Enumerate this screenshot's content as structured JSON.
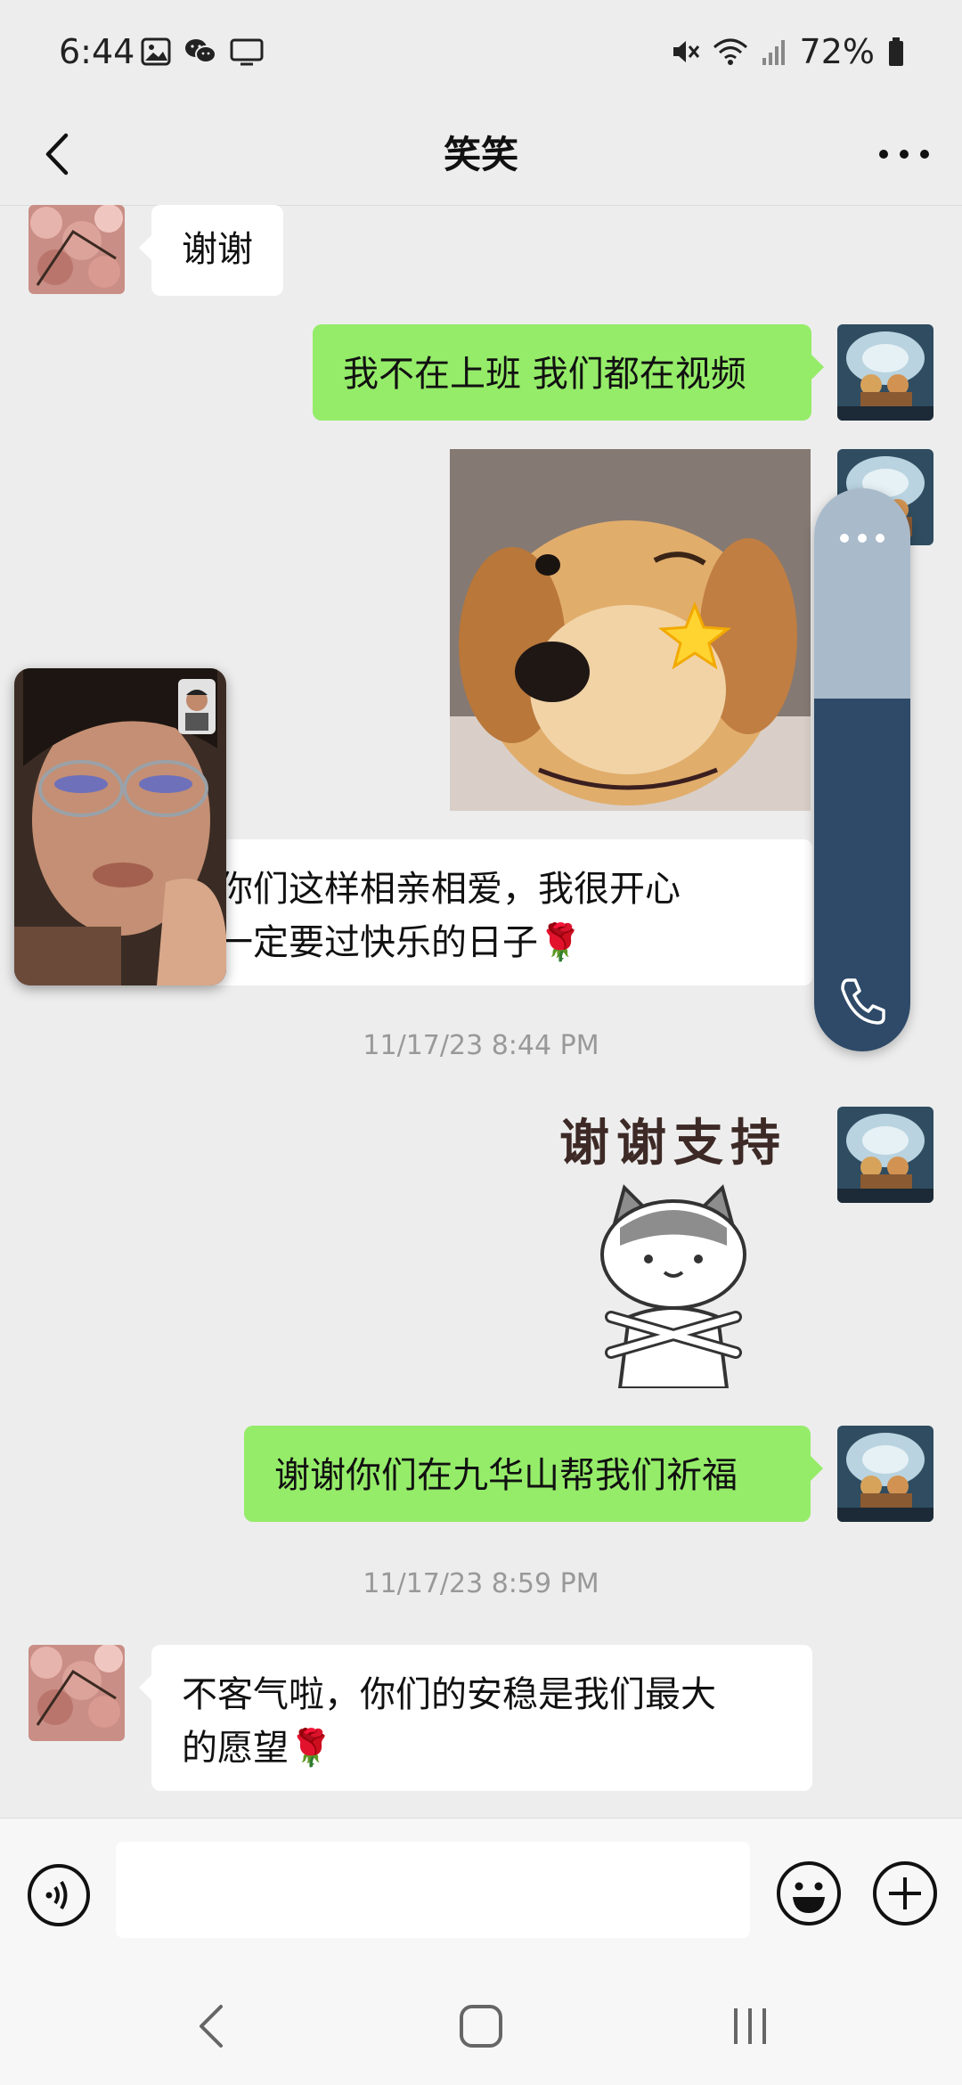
{
  "status_bar": {
    "time": "6:44",
    "battery": "72%",
    "icons_left": [
      "gallery-icon",
      "wechat-icon",
      "cast-icon"
    ],
    "icons_right": [
      "mute-icon",
      "wifi-icon",
      "signal-icon",
      "battery-icon"
    ]
  },
  "header": {
    "title": "笑笑"
  },
  "messages": [
    {
      "side": "in",
      "type": "text",
      "text": "谢谢"
    },
    {
      "side": "out",
      "type": "text",
      "text": "我不在上班 我们都在视频"
    },
    {
      "side": "out",
      "type": "image",
      "image": "golden-retriever-wink-sticker"
    },
    {
      "side": "in",
      "type": "text",
      "line1": "见你们这样相亲相爱，我很开心",
      "line2": "，一定要过快乐的日子🌹"
    },
    {
      "type": "timestamp",
      "text": "11/17/23 8:44 PM"
    },
    {
      "side": "out",
      "type": "sticker",
      "sticker_text": "谢谢支持"
    },
    {
      "side": "out",
      "type": "text",
      "text": "谢谢你们在九华山帮我们祈福"
    },
    {
      "type": "timestamp",
      "text": "11/17/23 8:59 PM"
    },
    {
      "side": "in",
      "type": "text",
      "line1": "不客气啦，你们的安稳是我们最大",
      "line2": "的愿望🌹"
    }
  ],
  "input": {
    "value": "",
    "placeholder": ""
  },
  "colors": {
    "background": "#ededed",
    "bubble_out": "#95ec69",
    "bubble_in": "#ffffff",
    "call_panel_top": "#a9bacb",
    "call_panel_bottom": "#2e4a68"
  }
}
